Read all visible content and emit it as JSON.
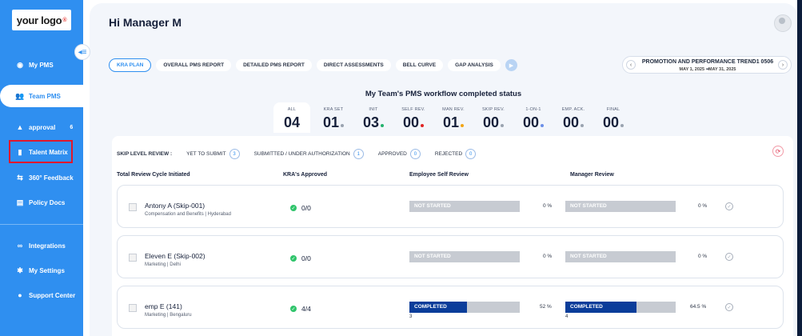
{
  "sidebar": {
    "logo_text": "your logo",
    "items": [
      {
        "label": "My PMS",
        "icon": "globe-icon"
      },
      {
        "label": "Team PMS",
        "icon": "people-icon"
      },
      {
        "label": "approval",
        "icon": "user-icon",
        "badge": "6"
      },
      {
        "label": "Talent Matrix",
        "icon": "book-icon"
      },
      {
        "label": "360° Feedback",
        "icon": "feedback-icon"
      },
      {
        "label": "Policy Docs",
        "icon": "document-icon"
      },
      {
        "label": "Integrations",
        "icon": "link-icon"
      },
      {
        "label": "My Settings",
        "icon": "gear-icon"
      },
      {
        "label": "Support Center",
        "icon": "support-icon"
      }
    ]
  },
  "header": {
    "title": "Hi Manager M"
  },
  "tabs": [
    "KRA PLAN",
    "OVERALL PMS REPORT",
    "DETAILED PMS REPORT",
    "DIRECT ASSESSMENTS",
    "BELL CURVE",
    "GAP ANALYSIS"
  ],
  "period": {
    "title": "PROMOTION AND PERFORMANCE TREND1 0506",
    "range": "MAY 1, 2025 - MAY 31, 2025"
  },
  "status": {
    "title": "My Team's PMS workflow completed status",
    "items": [
      {
        "label": "ALL",
        "value": "04",
        "color": ""
      },
      {
        "label": "KRA SET",
        "value": "01",
        "color": "#9aa3b0"
      },
      {
        "label": "INIT",
        "value": "03",
        "color": "#23b26d"
      },
      {
        "label": "SELF REV.",
        "value": "00",
        "color": "#e02424"
      },
      {
        "label": "MAN REV.",
        "value": "01",
        "color": "#f2a516"
      },
      {
        "label": "SKIP REV.",
        "value": "00",
        "color": "#9aa3b0"
      },
      {
        "label": "1-ON-1",
        "value": "00",
        "color": "#6b8ee8"
      },
      {
        "label": "EMP. ACK.",
        "value": "00",
        "color": "#9aa3b0"
      },
      {
        "label": "FINAL",
        "value": "00",
        "color": "#9aa3b0"
      }
    ]
  },
  "skip_level": {
    "title": "SKIP LEVEL REVIEW :",
    "filters": [
      {
        "label": "YET TO SUBMIT",
        "count": "3"
      },
      {
        "label": "SUBMITTED / UNDER AUTHORIZATION",
        "count": "1"
      },
      {
        "label": "APPROVED",
        "count": "0"
      },
      {
        "label": "REJECTED",
        "count": "0"
      }
    ]
  },
  "columns": {
    "initiated": "Total Review Cycle Initiated",
    "kra": "KRA's Approved",
    "self": "Employee Self Review",
    "manager": "Manager Review"
  },
  "rows": [
    {
      "name": "Antony A (Skip-001)",
      "dept": "Compensation and Benefits | Hyderabad",
      "kra": "0/0",
      "self_status": "NOT STARTED",
      "self_progress": 0,
      "self_pct": "0 %",
      "self_count": "",
      "mgr_status": "NOT STARTED",
      "mgr_progress": 0,
      "mgr_pct": "0 %",
      "mgr_count": ""
    },
    {
      "name": "Eleven E (Skip-002)",
      "dept": "Marketing | Delhi",
      "kra": "0/0",
      "self_status": "NOT STARTED",
      "self_progress": 0,
      "self_pct": "0 %",
      "self_count": "",
      "mgr_status": "NOT STARTED",
      "mgr_progress": 0,
      "mgr_pct": "0 %",
      "mgr_count": ""
    },
    {
      "name": "emp E (141)",
      "dept": "Marketing | Bengaluru",
      "kra": "4/4",
      "self_status": "COMPLETED",
      "self_progress": 52,
      "self_pct": "52 %",
      "self_count": "3",
      "mgr_status": "COMPLETED",
      "mgr_progress": 64.5,
      "mgr_pct": "64.5 %",
      "mgr_count": "4"
    }
  ]
}
